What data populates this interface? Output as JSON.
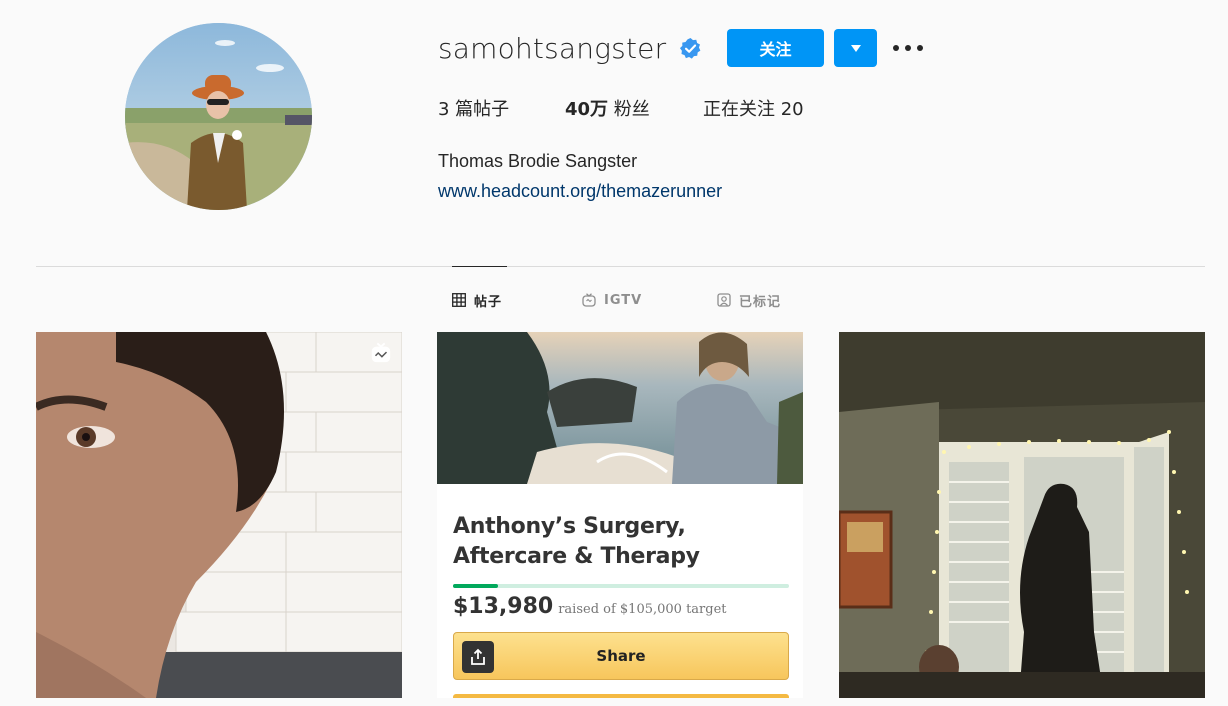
{
  "profile": {
    "username": "samohtsangster",
    "verified": true,
    "follow_label": "关注",
    "full_name": "Thomas Brodie Sangster",
    "bio_link": "www.headcount.org/themazerunner"
  },
  "stats": {
    "posts_count": "3",
    "posts_label": " 篇帖子",
    "followers_count": "40万",
    "followers_label": " 粉丝",
    "following_label": "正在关注 ",
    "following_count": "20"
  },
  "tabs": [
    {
      "label": "帖子",
      "icon": "grid-icon",
      "active": true
    },
    {
      "label": "IGTV",
      "icon": "igtv-icon",
      "active": false
    },
    {
      "label": "已标记",
      "icon": "tagged-icon",
      "active": false
    }
  ],
  "posts": [
    {
      "type": "igtv-video",
      "badge_icon": "igtv-badge-icon"
    },
    {
      "type": "fundraiser-screenshot",
      "title": "Anthony’s Surgery, Aftercare & Therapy",
      "raised": "$13,980",
      "target_text": "raised of $105,000 target",
      "progress_fraction": 0.133,
      "share_label": "Share"
    },
    {
      "type": "photo"
    }
  ],
  "colors": {
    "accent": "#0095f6",
    "link": "#00376b",
    "verified": "#3897f0",
    "background": "#fafafa",
    "divider": "#dbdbdb"
  }
}
